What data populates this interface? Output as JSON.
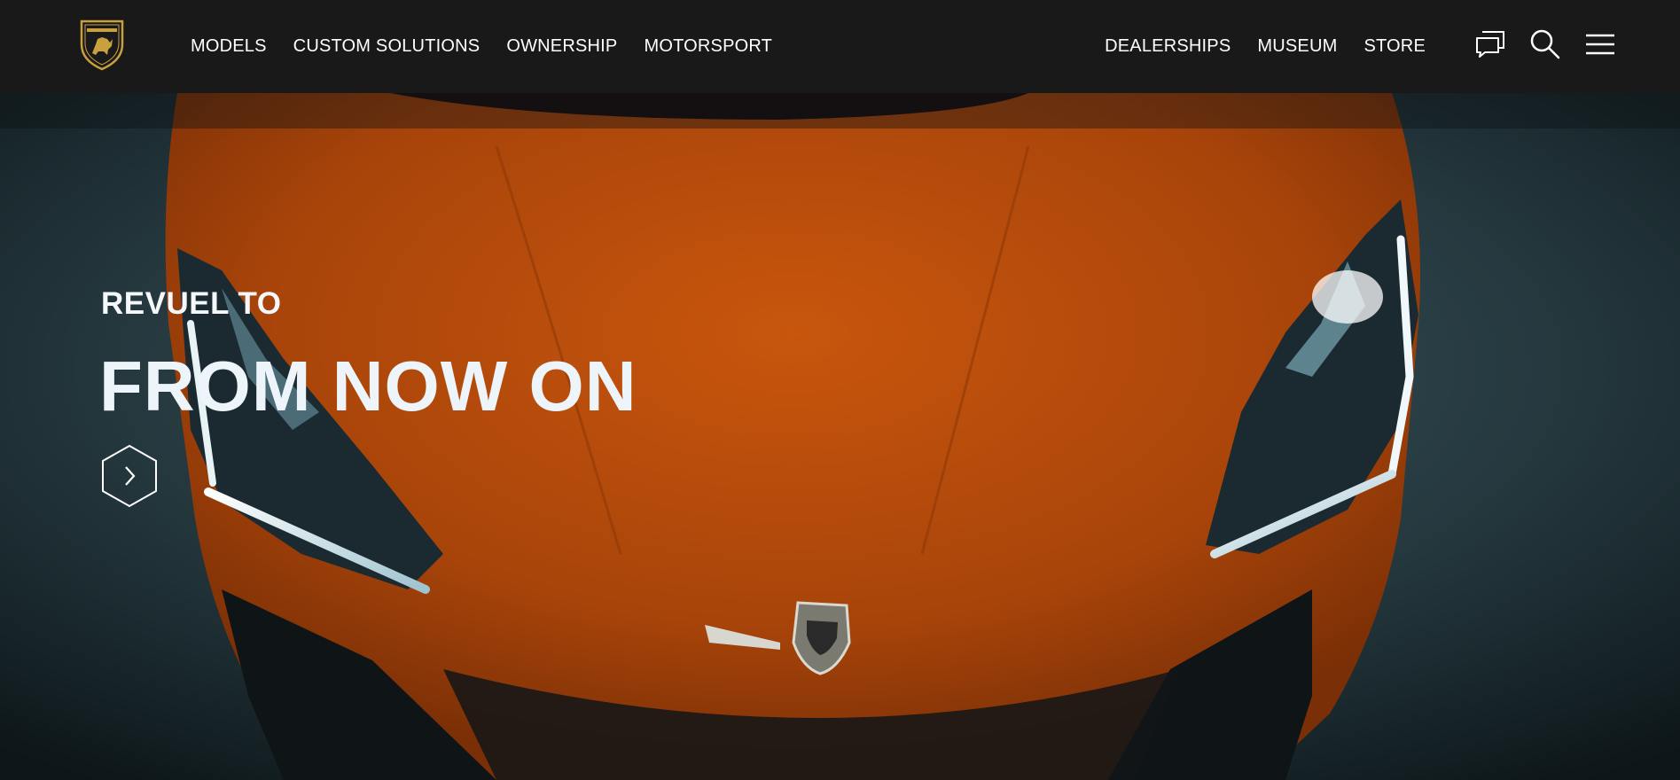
{
  "header": {
    "logo_name": "lamborghini-shield-logo",
    "nav_left": [
      "MODELS",
      "CUSTOM SOLUTIONS",
      "OWNERSHIP",
      "MOTORSPORT"
    ],
    "nav_right": [
      "DEALERSHIPS",
      "MUSEUM",
      "STORE"
    ],
    "tools": [
      {
        "name": "chat-icon"
      },
      {
        "name": "search-icon"
      },
      {
        "name": "menu-icon"
      }
    ]
  },
  "hero": {
    "eyebrow": "REVUEL TO",
    "title": "FROM NOW ON",
    "cta_icon": "chevron-right-hexagon-icon",
    "image": "orange-supercar-front-top-view"
  },
  "colors": {
    "header_bg": "#191919",
    "car_orange": "#c4520c",
    "text_white": "#ffffff",
    "logo_gold": "#c9a040"
  }
}
